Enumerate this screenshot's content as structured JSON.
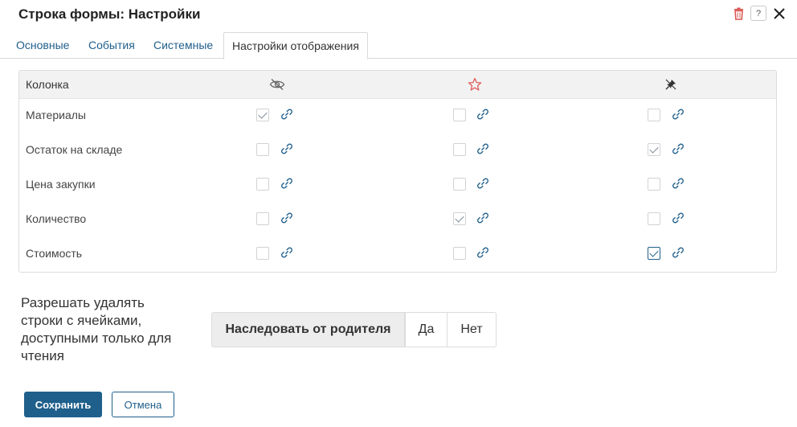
{
  "dialog": {
    "title": "Строка формы: Настройки"
  },
  "tabs": [
    {
      "label": "Основные"
    },
    {
      "label": "События"
    },
    {
      "label": "Системные"
    },
    {
      "label": "Настройки отображения",
      "active": true
    }
  ],
  "grid": {
    "column_header": "Колонка",
    "header_icons": [
      "eye-off-icon",
      "star-icon",
      "pin-off-icon"
    ],
    "rows": [
      {
        "label": "Материалы",
        "checks": [
          true,
          false,
          false
        ]
      },
      {
        "label": "Остаток на складе",
        "checks": [
          false,
          false,
          true
        ]
      },
      {
        "label": "Цена закупки",
        "checks": [
          false,
          false,
          false
        ]
      },
      {
        "label": "Количество",
        "checks": [
          false,
          true,
          false
        ]
      },
      {
        "label": "Стоимость",
        "checks": [
          false,
          false,
          true
        ]
      }
    ]
  },
  "permission": {
    "label": "Разрешать удалять строки с ячейками, доступными только для чтения",
    "options": [
      "Наследовать от родителя",
      "Да",
      "Нет"
    ],
    "selected": "Наследовать от родителя"
  },
  "footer": {
    "save_label": "Сохранить",
    "cancel_label": "Отмена"
  },
  "colors": {
    "accent": "#1f5f8b",
    "delete": "#d9534f",
    "star": "#e05a5a"
  }
}
